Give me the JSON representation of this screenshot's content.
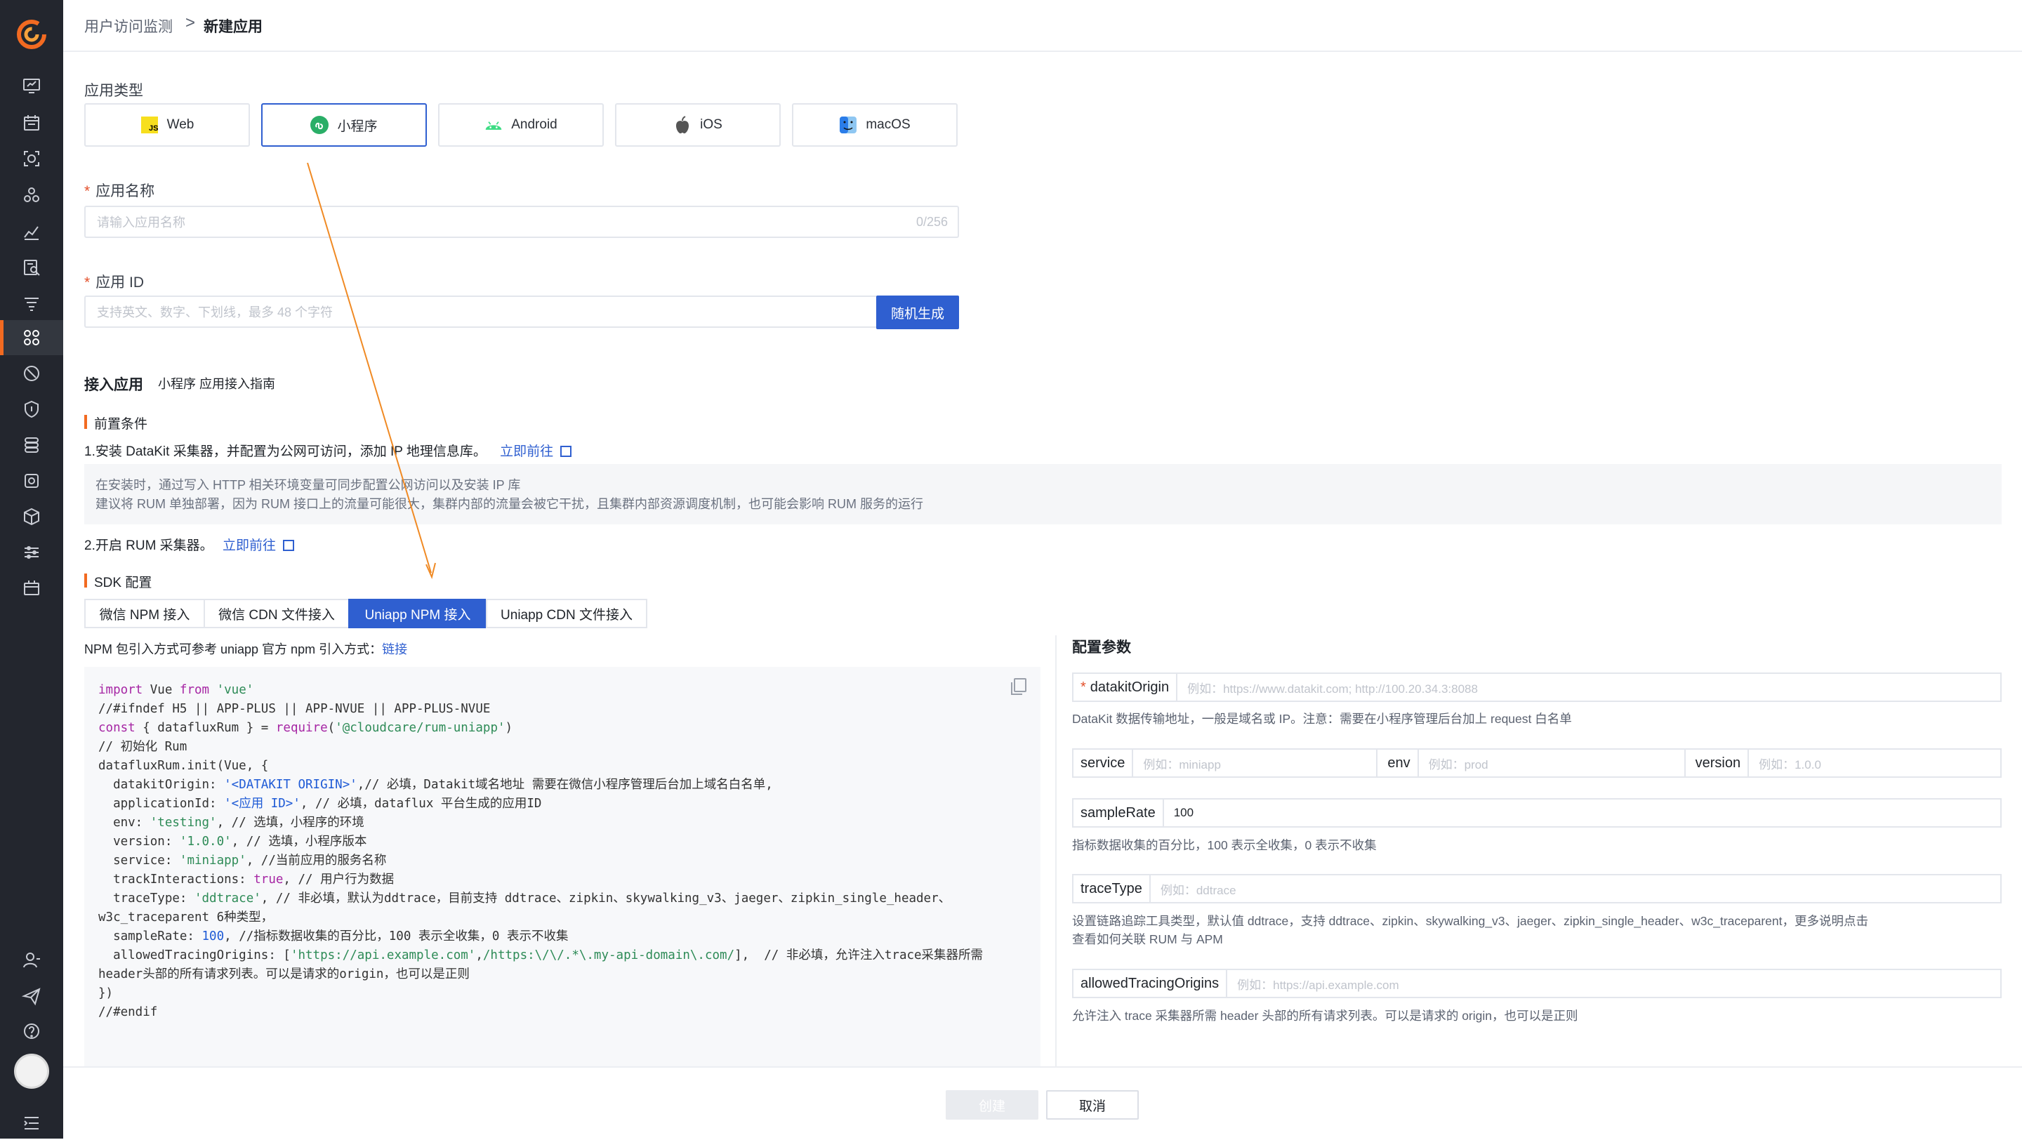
{
  "breadcrumb": {
    "parent": "用户访问监测",
    "separator": ">",
    "current": "新建应用"
  },
  "app_type": {
    "label": "应用类型",
    "options": [
      {
        "name": "Web",
        "icon": "js-icon"
      },
      {
        "name": "小程序",
        "icon": "miniprogram-icon",
        "selected": true
      },
      {
        "name": "Android",
        "icon": "android-icon"
      },
      {
        "name": "iOS",
        "icon": "apple-icon"
      },
      {
        "name": "macOS",
        "icon": "finder-icon"
      }
    ]
  },
  "app_name": {
    "label": "应用名称",
    "placeholder": "请输入应用名称",
    "counter": "0/256"
  },
  "app_id": {
    "label": "应用 ID",
    "placeholder": "支持英文、数字、下划线，最多 48 个字符",
    "button": "随机生成"
  },
  "access": {
    "title": "接入应用",
    "guide_link": "小程序 应用接入指南",
    "prereq_title": "前置条件",
    "step1": "1.安装 DataKit 采集器，并配置为公网可访问，添加 IP 地理信息库。",
    "step1_link": "立即前往",
    "note1": "在安装时，通过写入 HTTP 相关环境变量可同步配置公网访问以及安装 IP 库",
    "note2": "建议将 RUM 单独部署，因为 RUM 接口上的流量可能很大，集群内部的流量会被它干扰，且集群内部资源调度机制，也可能会影响 RUM 服务的运行",
    "step2": "2.开启 RUM 采集器。",
    "step2_link": "立即前往",
    "sdk_title": "SDK 配置"
  },
  "tabs": [
    "微信 NPM 接入",
    "微信 CDN 文件接入",
    "Uniapp NPM 接入",
    "Uniapp CDN 文件接入"
  ],
  "npm_note": "NPM 包引入方式可参考 uniapp 官方 npm 引入方式：",
  "npm_link": "链接",
  "config": {
    "title": "配置参数",
    "datakit_label": "datakitOrigin",
    "datakit_placeholder": "例如：https://www.datakit.com; http://100.20.34.3:8088",
    "datakit_help": "DataKit 数据传输地址，一般是域名或 IP。注意：需要在小程序管理后台加上 request 白名单",
    "service_label": "service",
    "service_placeholder": "例如：miniapp",
    "env_label": "env",
    "env_placeholder": "例如：prod",
    "version_label": "version",
    "version_placeholder": "例如：1.0.0",
    "samplerate_label": "sampleRate",
    "samplerate_value": "100",
    "samplerate_help": "指标数据收集的百分比，100 表示全收集，0 表示不收集",
    "tracetype_label": "traceType",
    "tracetype_placeholder": "例如：ddtrace",
    "tracetype_help": "设置链路追踪工具类型，默认值 ddtrace，支持 ddtrace、zipkin、skywalking_v3、jaeger、zipkin_single_header、w3c_traceparent，更多说明点击",
    "tracetype_link": "查看如何关联 RUM 与 APM",
    "origins_label": "allowedTracingOrigins",
    "origins_placeholder": "例如：https://api.example.com",
    "origins_help": "允许注入 trace 采集器所需 header 头部的所有请求列表。可以是请求的 origin，也可以是正则"
  },
  "footer": {
    "create": "创建",
    "cancel": "取消"
  },
  "colors": {
    "primary": "#2f5fd0",
    "accent": "#f26a21",
    "sidebar": "#23262e"
  }
}
